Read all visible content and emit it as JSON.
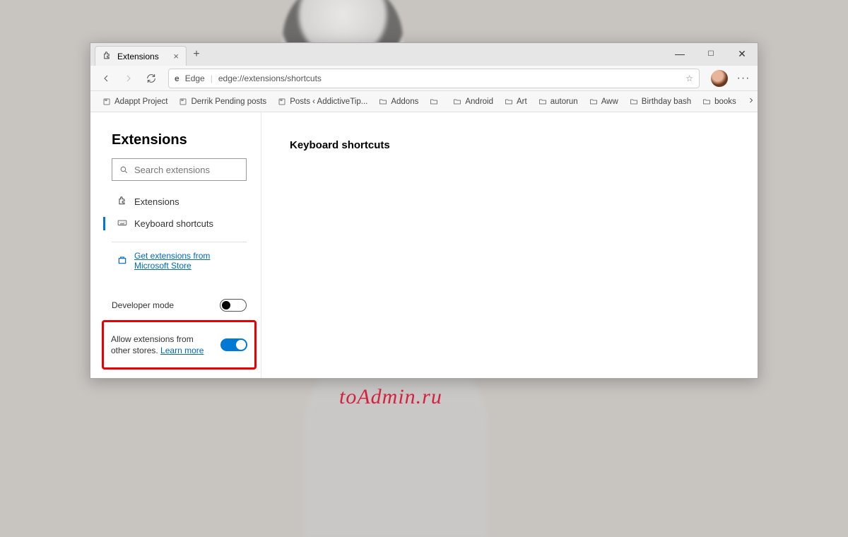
{
  "tab": {
    "title": "Extensions"
  },
  "omnibox": {
    "scheme_label": "Edge",
    "url": "edge://extensions/shortcuts"
  },
  "bookmarks": [
    "Adappt Project",
    "Derrik Pending posts",
    "Posts ‹ AddictiveTip...",
    "Addons",
    "",
    "Android",
    "Art",
    "autorun",
    "Aww",
    "Birthday bash",
    "books"
  ],
  "sidebar": {
    "title": "Extensions",
    "search_placeholder": "Search extensions",
    "nav": {
      "extensions": "Extensions",
      "shortcuts": "Keyboard shortcuts"
    },
    "store_link": "Get extensions from Microsoft Store",
    "dev_mode": {
      "label": "Developer mode",
      "on": false
    },
    "allow_other": {
      "label": "Allow extensions from other stores.",
      "learn_more": "Learn more",
      "on": true
    }
  },
  "main": {
    "heading": "Keyboard shortcuts"
  },
  "watermark": "toAdmin.ru"
}
